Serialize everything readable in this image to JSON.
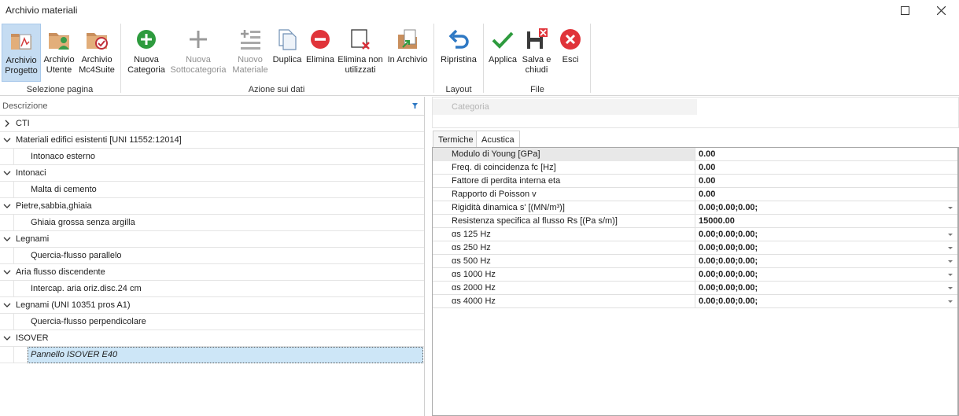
{
  "window": {
    "title": "Archivio materiali"
  },
  "ribbon": {
    "groups": {
      "page": "Selezione pagina",
      "data": "Azione sui dati",
      "layout": "Layout",
      "file": "File"
    },
    "buttons": {
      "archivio_progetto": "Archivio\nProgetto",
      "archivio_utente": "Archivio\nUtente",
      "archivio_mc4suite": "Archivio\nMc4Suite",
      "nuova_categoria": "Nuova\nCategoria",
      "nuova_sottocategoria": "Nuova\nSottocategoria",
      "nuovo_materiale": "Nuovo\nMateriale",
      "duplica": "Duplica",
      "elimina": "Elimina",
      "elimina_non_utilizzati": "Elimina non\nutilizzati",
      "in_archivio": "In Archivio",
      "ripristina": "Ripristina",
      "applica": "Applica",
      "salva_chiudi": "Salva e\nchiudi",
      "esci": "Esci"
    }
  },
  "tree": {
    "column_header": "Descrizione",
    "rows": [
      {
        "label": "CTI",
        "level": 0,
        "expanded": false
      },
      {
        "label": "Materiali edifici esistenti [UNI 11552:12014]",
        "level": 0,
        "expanded": true
      },
      {
        "label": "Intonaco esterno",
        "level": 1
      },
      {
        "label": "Intonaci",
        "level": 0,
        "expanded": true
      },
      {
        "label": "Malta di cemento",
        "level": 1
      },
      {
        "label": "Pietre,sabbia,ghiaia",
        "level": 0,
        "expanded": true
      },
      {
        "label": "Ghiaia grossa senza argilla",
        "level": 1
      },
      {
        "label": "Legnami",
        "level": 0,
        "expanded": true
      },
      {
        "label": "Quercia-flusso parallelo",
        "level": 1
      },
      {
        "label": "Aria flusso discendente",
        "level": 0,
        "expanded": true
      },
      {
        "label": "Intercap. aria oriz.disc.24 cm",
        "level": 1
      },
      {
        "label": "Legnami (UNI 10351 pros A1)",
        "level": 0,
        "expanded": true
      },
      {
        "label": "Quercia-flusso perpendicolare",
        "level": 1
      },
      {
        "label": "ISOVER",
        "level": 0,
        "expanded": true
      },
      {
        "label": "Pannello ISOVER E40",
        "level": 1,
        "selected": true
      }
    ]
  },
  "details": {
    "category_label": "Categoria",
    "tabs": [
      "Termiche",
      "Acustica"
    ],
    "active_tab": "Acustica",
    "properties": [
      {
        "name": "Modulo di Young [GPa]",
        "value": "0.00",
        "dropdown": false
      },
      {
        "name": "Freq. di coincidenza fc [Hz]",
        "value": "0.00",
        "dropdown": false
      },
      {
        "name": "Fattore di perdita interna eta",
        "value": "0.00",
        "dropdown": false
      },
      {
        "name": "Rapporto di Poisson v",
        "value": "0.00",
        "dropdown": false
      },
      {
        "name": "Rigidità dinamica s' [(MN/m³)]",
        "value": "0.00;0.00;0.00;",
        "dropdown": true
      },
      {
        "name": "Resistenza specifica al flusso Rs [(Pa s/m)]",
        "value": "15000.00",
        "dropdown": false
      },
      {
        "name": "αs 125 Hz",
        "value": "0.00;0.00;0.00;",
        "dropdown": true
      },
      {
        "name": "αs 250 Hz",
        "value": "0.00;0.00;0.00;",
        "dropdown": true
      },
      {
        "name": "αs 500 Hz",
        "value": "0.00;0.00;0.00;",
        "dropdown": true
      },
      {
        "name": "αs 1000 Hz",
        "value": "0.00;0.00;0.00;",
        "dropdown": true
      },
      {
        "name": "αs 2000 Hz",
        "value": "0.00;0.00;0.00;",
        "dropdown": true
      },
      {
        "name": "αs 4000 Hz",
        "value": "0.00;0.00;0.00;",
        "dropdown": true
      }
    ]
  },
  "colors": {
    "accent_selected": "#c5dcf2",
    "green": "#2e9b3e",
    "red": "#e0343a",
    "blue": "#2f79c4"
  }
}
